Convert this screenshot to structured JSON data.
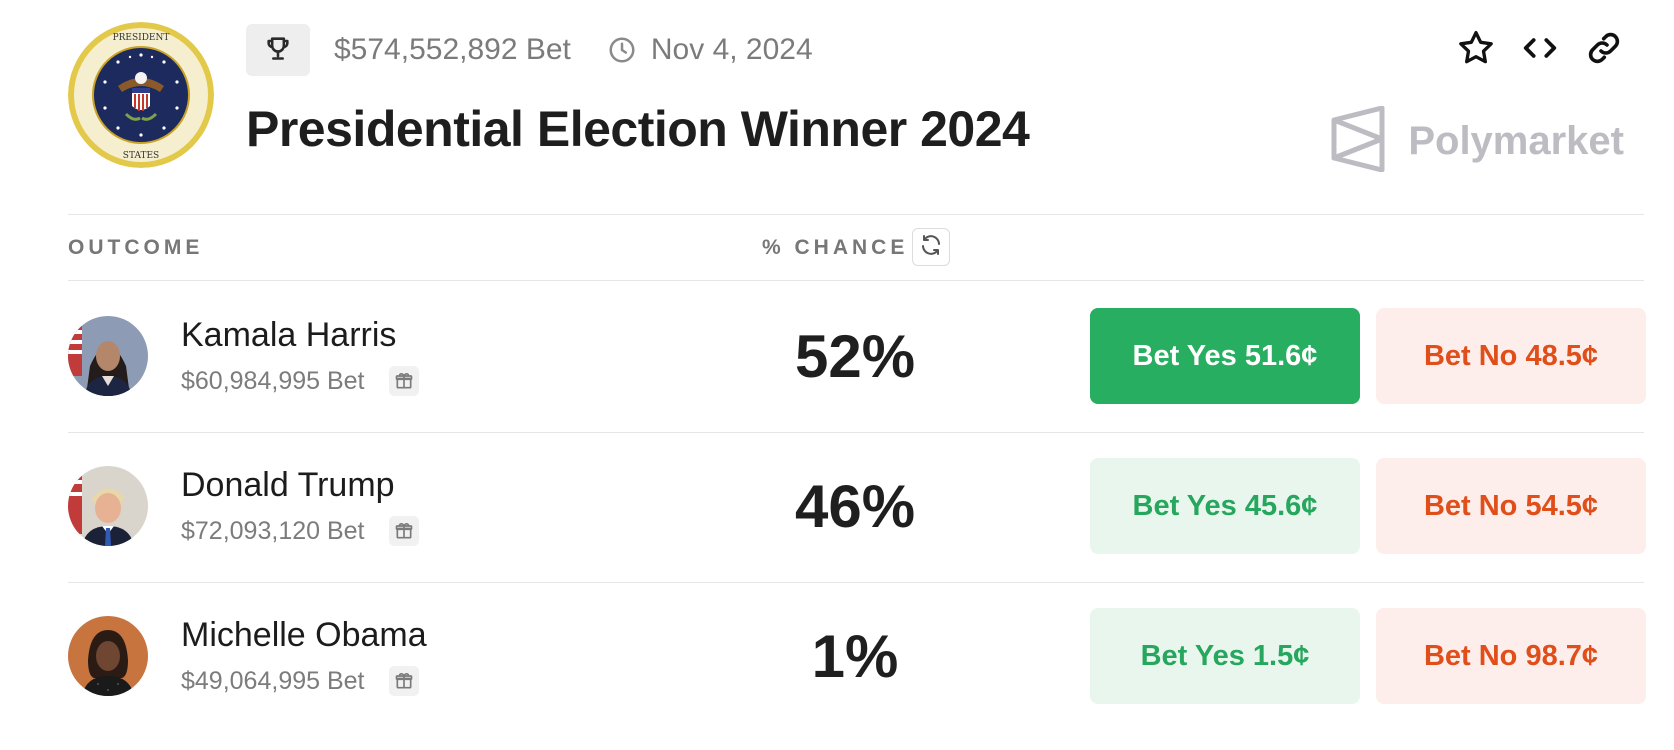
{
  "header": {
    "total_bet": "$574,552,892 Bet",
    "date": "Nov 4, 2024",
    "title": "Presidential Election Winner 2024",
    "brand": "Polymarket",
    "seal_text": "SEAL OF THE PRESIDENT OF THE UNITED STATES",
    "icons": [
      "trophy-icon",
      "clock-icon",
      "star-icon",
      "embed-code-icon",
      "link-icon",
      "polymarket-logo-icon"
    ]
  },
  "table": {
    "outcome_header": "OUTCOME",
    "chance_header": "% CHANCE",
    "refresh_icon": "refresh-icon",
    "rows": [
      {
        "name": "Kamala Harris",
        "bet": "$60,984,995 Bet",
        "chance": "52%",
        "yes_label": "Bet Yes 51.6¢",
        "no_label": "Bet No 48.5¢",
        "yes_style": "solid"
      },
      {
        "name": "Donald Trump",
        "bet": "$72,093,120 Bet",
        "chance": "46%",
        "yes_label": "Bet Yes 45.6¢",
        "no_label": "Bet No 54.5¢",
        "yes_style": "soft"
      },
      {
        "name": "Michelle Obama",
        "bet": "$49,064,995 Bet",
        "chance": "1%",
        "yes_label": "Bet Yes 1.5¢",
        "no_label": "Bet No 98.7¢",
        "yes_style": "soft"
      }
    ]
  },
  "colors": {
    "yes_solid_bg": "#27ae60",
    "yes_soft_bg": "#e9f6ee",
    "yes_soft_text": "#27a65d",
    "no_bg": "#fdeeec",
    "no_text": "#e04e1a"
  }
}
